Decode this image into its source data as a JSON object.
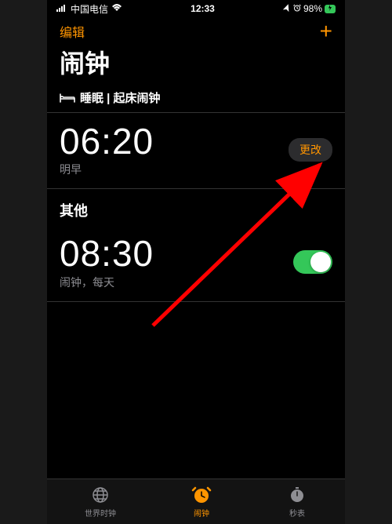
{
  "status": {
    "carrier": "中国电信",
    "time": "12:33",
    "battery": "98%"
  },
  "nav": {
    "edit": "编辑"
  },
  "title": "闹钟",
  "sleep": {
    "header": "睡眠 | 起床闹钟",
    "time": "06:20",
    "subtitle": "明早",
    "change": "更改"
  },
  "other": {
    "header": "其他",
    "time": "08:30",
    "subtitle": "闹钟，每天",
    "enabled": true
  },
  "tabs": {
    "worldclock": "世界时钟",
    "alarm": "闹钟",
    "stopwatch": "秒表"
  }
}
